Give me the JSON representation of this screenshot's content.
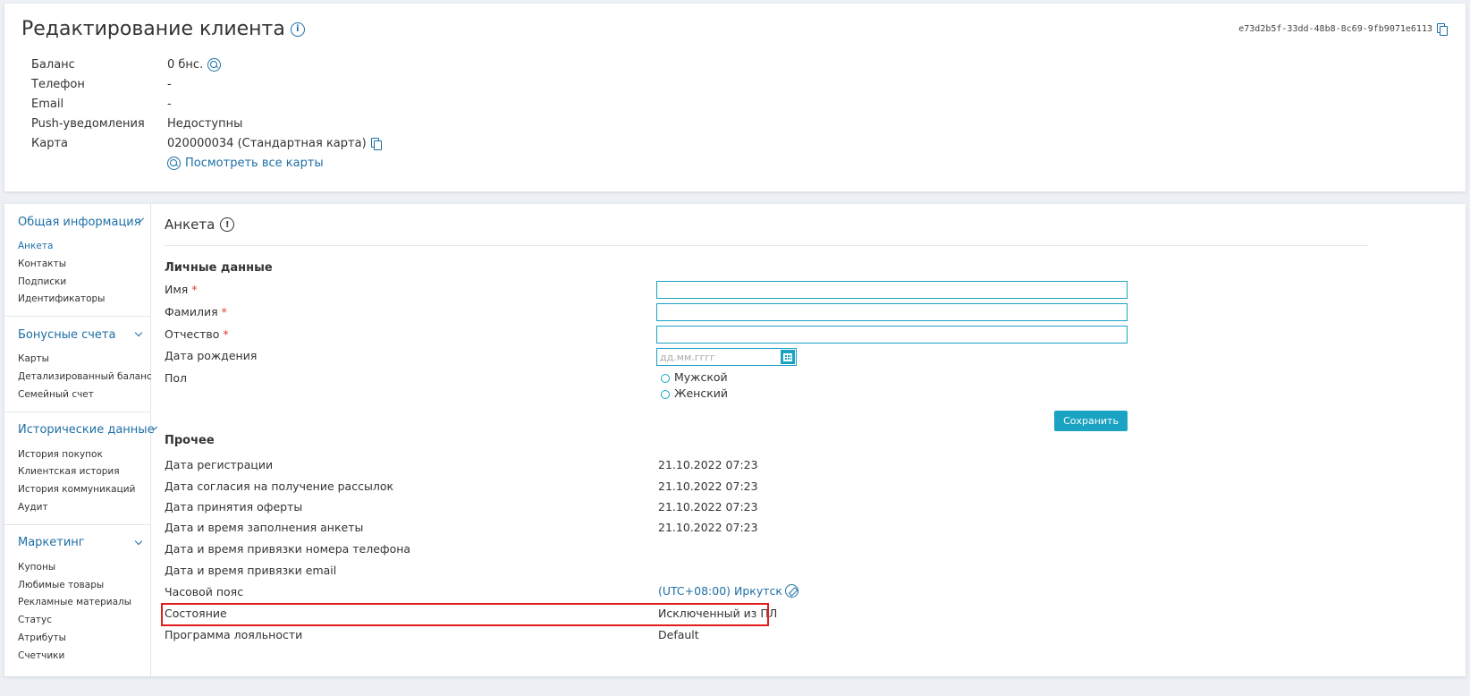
{
  "header": {
    "title": "Редактирование клиента",
    "client_id": "e73d2b5f-33dd-48b8-8c69-9fb9071e6113"
  },
  "client_info": {
    "balance_label": "Баланс",
    "balance_value": "0 бнс.",
    "phone_label": "Телефон",
    "phone_value": "-",
    "email_label": "Email",
    "email_value": "-",
    "push_label": "Push-уведомления",
    "push_value": "Недоступны",
    "card_label": "Карта",
    "card_value": "020000034 (Стандартная карта)",
    "view_cards_link": "Посмотреть все карты"
  },
  "sidebar": {
    "groups": [
      {
        "title": "Общая информация",
        "items": [
          "Анкета",
          "Контакты",
          "Подписки",
          "Идентификаторы"
        ]
      },
      {
        "title": "Бонусные счета",
        "items": [
          "Карты",
          "Детализированный баланс",
          "Семейный счет"
        ]
      },
      {
        "title": "Исторические данные",
        "items": [
          "История покупок",
          "Клиентская история",
          "История коммуникаций",
          "Аудит"
        ]
      },
      {
        "title": "Маркетинг",
        "items": [
          "Купоны",
          "Любимые товары",
          "Рекламные материалы",
          "Статус",
          "Атрибуты",
          "Счетчики"
        ]
      }
    ]
  },
  "section": {
    "title": "Анкета"
  },
  "personal": {
    "heading": "Личные данные",
    "first_name_label": "Имя",
    "last_name_label": "Фамилия",
    "middle_name_label": "Отчество",
    "required_mark": "*",
    "birth_label": "Дата рождения",
    "birth_placeholder": "дд.мм.гггг",
    "gender_label": "Пол",
    "gender_male": "Мужской",
    "gender_female": "Женский",
    "save_label": "Сохранить"
  },
  "other": {
    "heading": "Прочее",
    "rows": [
      {
        "label": "Дата регистрации",
        "value": "21.10.2022 07:23"
      },
      {
        "label": "Дата согласия на получение рассылок",
        "value": "21.10.2022 07:23"
      },
      {
        "label": "Дата принятия оферты",
        "value": "21.10.2022 07:23"
      },
      {
        "label": "Дата и время заполнения анкеты",
        "value": "21.10.2022 07:23"
      },
      {
        "label": "Дата и время привязки номера телефона",
        "value": ""
      },
      {
        "label": "Дата и время привязки email",
        "value": ""
      },
      {
        "label": "Часовой пояс",
        "value": "(UTC+08:00) Иркутск"
      },
      {
        "label": "Состояние",
        "value": "Исключенный из ПЛ"
      },
      {
        "label": "Программа лояльности",
        "value": "Default"
      }
    ]
  },
  "colors": {
    "accent": "#1aa3c2",
    "link": "#1d6fa5",
    "highlight": "#e21b1b"
  }
}
